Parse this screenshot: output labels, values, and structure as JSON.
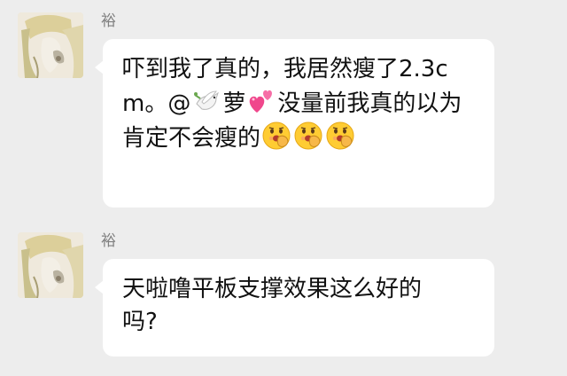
{
  "messages": [
    {
      "sender": "裕",
      "text_1": "吓到我了真的，我居然瘦了2.3cm。@",
      "text_2": "萝",
      "text_3": "没量前我真的以为肯定不会瘦的"
    },
    {
      "sender": "裕",
      "text_1": "天啦噜平板支撑效果这么好的吗?"
    }
  ],
  "icons": {
    "avatar": "avatar-image",
    "dove": "dove-emoji-icon",
    "hearts": "two-hearts-emoji-icon",
    "face": "face-with-hand-over-mouth-emoji-icon"
  },
  "colors": {
    "background": "#ededed",
    "bubble": "#ffffff",
    "sender_name": "#7f7f7f",
    "text": "#111111"
  }
}
